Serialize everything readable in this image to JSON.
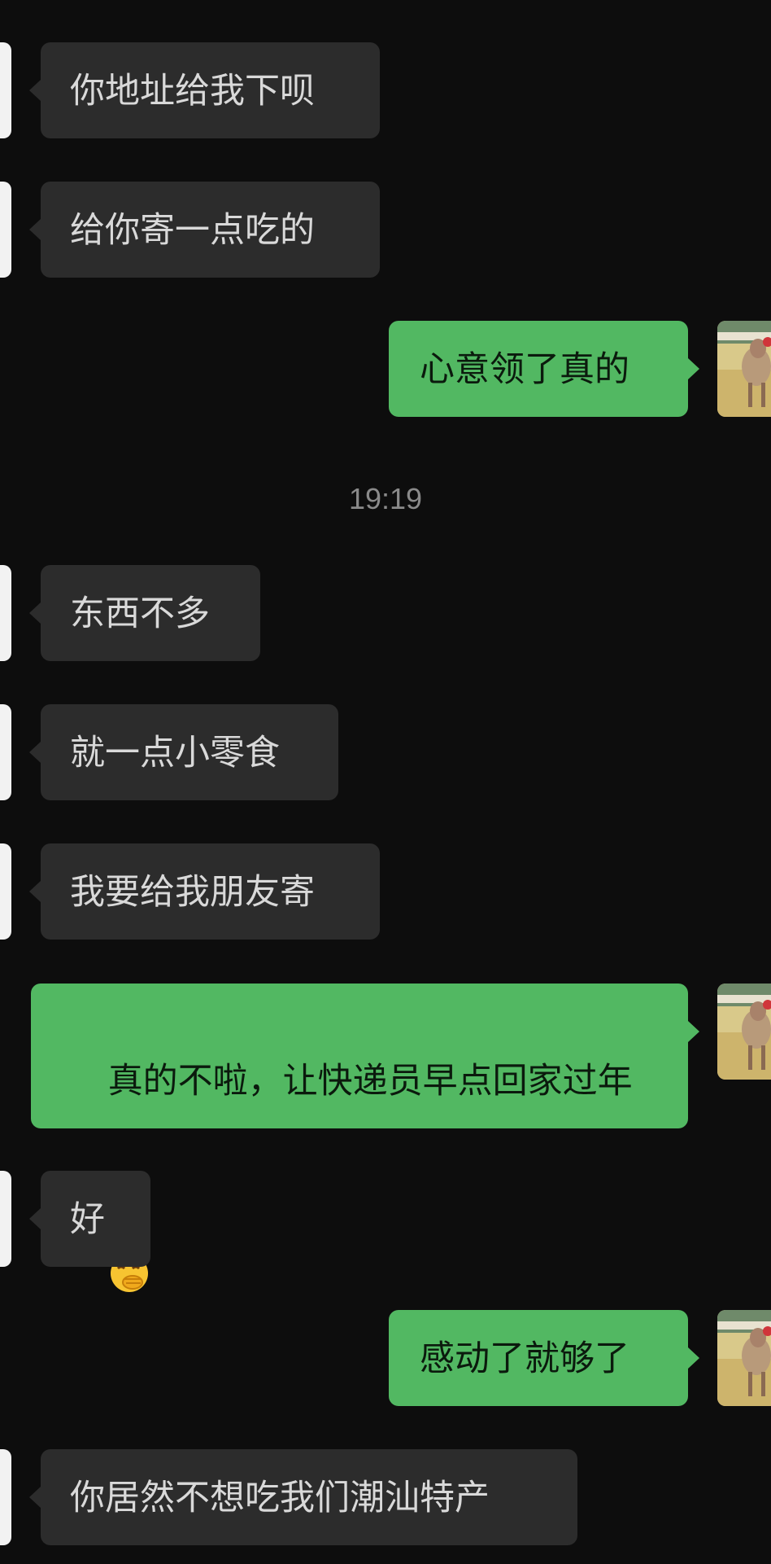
{
  "messages": [
    {
      "side": "in",
      "text": "你地址给我下呗"
    },
    {
      "side": "in",
      "text": "给你寄一点吃的"
    },
    {
      "side": "out",
      "text": "心意领了真的"
    },
    {
      "side": "in",
      "text": "东西不多"
    },
    {
      "side": "in",
      "text": "就一点小零食"
    },
    {
      "side": "in",
      "text": "我要给我朋友寄"
    },
    {
      "side": "out",
      "text_line1": "真的不啦，让快递员早点回家过年",
      "emoji": "hand-over-mouth-emoji"
    },
    {
      "side": "in",
      "text": "好"
    },
    {
      "side": "out",
      "text": "感动了就够了"
    },
    {
      "side": "in",
      "text": "你居然不想吃我们潮汕特产"
    }
  ],
  "timestamp": "19:19",
  "colors": {
    "background": "#0d0d0d",
    "incoming_bubble": "#2c2c2c",
    "outgoing_bubble": "#52b862",
    "timestamp_text": "#8a8a8a"
  }
}
